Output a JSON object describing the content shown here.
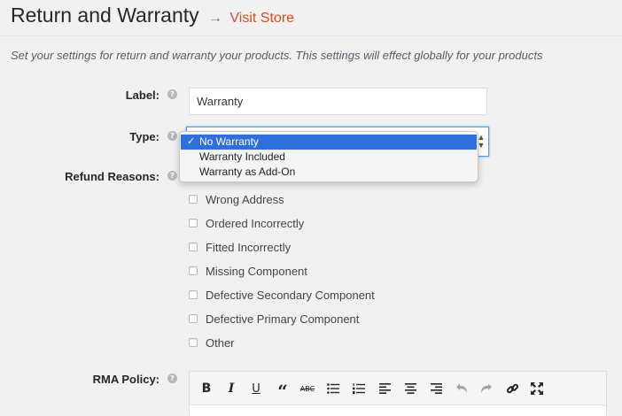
{
  "header": {
    "title": "Return and Warranty",
    "arrow": "→",
    "visit_store": "Visit Store"
  },
  "description": "Set your settings for return and warranty your products. This settings will effect globally for your products",
  "fields": {
    "label": {
      "label": "Label:",
      "value": "Warranty"
    },
    "type": {
      "label": "Type:",
      "options": [
        {
          "label": "No Warranty",
          "selected": true
        },
        {
          "label": "Warranty Included",
          "selected": false
        },
        {
          "label": "Warranty as Add-On",
          "selected": false
        }
      ]
    },
    "refund_reasons": {
      "label": "Refund Reasons:",
      "items": [
        {
          "label": "Wrong Address",
          "checked": false
        },
        {
          "label": "Ordered Incorrectly",
          "checked": false
        },
        {
          "label": "Fitted Incorrectly",
          "checked": false
        },
        {
          "label": "Missing Component",
          "checked": false
        },
        {
          "label": "Defective Secondary Component",
          "checked": false
        },
        {
          "label": "Defective Primary Component",
          "checked": false
        },
        {
          "label": "Other",
          "checked": false
        }
      ]
    },
    "rma_policy": {
      "label": "RMA Policy:",
      "toolbar": [
        "bold-icon",
        "italic-icon",
        "underline-icon",
        "blockquote-icon",
        "strikethrough-icon",
        "bullet-list-icon",
        "numbered-list-icon",
        "align-left-icon",
        "align-center-icon",
        "align-right-icon",
        "undo-icon",
        "redo-icon",
        "link-icon",
        "fullscreen-icon"
      ]
    }
  },
  "help_icon_glyph": "?",
  "checkmark": "✓",
  "colors": {
    "link": "#d54e21",
    "selection": "#2f6fd9",
    "focus_border": "#5b9dd9"
  }
}
